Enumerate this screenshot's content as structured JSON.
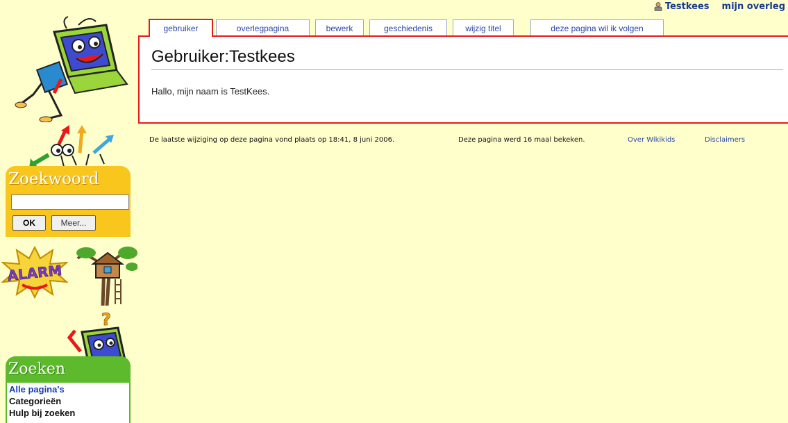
{
  "personal": {
    "username": "Testkees",
    "talk": "mijn overleg"
  },
  "search": {
    "title": "Zoekwoord",
    "input_value": "",
    "ok_label": "OK",
    "more_label": "Meer..."
  },
  "alarm_label": "ALARM",
  "zoeken": {
    "title": "Zoeken",
    "links": [
      "Alle pagina's",
      "Categorieën",
      "Hulp bij zoeken"
    ]
  },
  "tabs": [
    "gebruiker",
    "overlegpagina",
    "bewerk",
    "geschiedenis",
    "wijzig titel",
    "deze pagina wil ik volgen"
  ],
  "article": {
    "title": "Gebruiker:Testkees",
    "body": "Hallo, mijn naam is TestKees."
  },
  "footer": {
    "last_modified": "De laatste wijziging op deze pagina vond plaats op 18:41, 8 juni 2006.",
    "views": "Deze pagina werd 16 maal bekeken.",
    "about": "Over Wikikids",
    "disclaimers": "Disclaimers"
  },
  "colors": {
    "background": "#ffffcc",
    "accent_red": "#e8191b",
    "link_blue": "#2a46a8",
    "search_yellow": "#f8c61c",
    "zoeken_green": "#5cba2c"
  },
  "icons": [
    "user-icon",
    "computer-mascot-icon",
    "arrows-mascot-icon",
    "alarm-icon",
    "treehouse-icon",
    "question-computer-icon"
  ]
}
